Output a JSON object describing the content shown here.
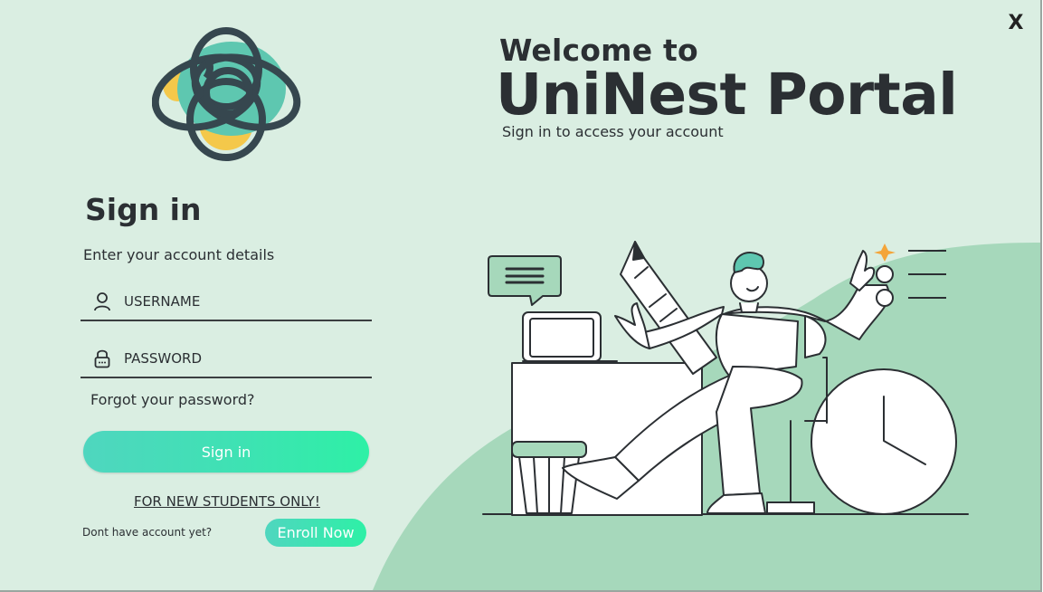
{
  "window": {
    "close_label": "X"
  },
  "hero": {
    "welcome": "Welcome to",
    "title": "UniNest Portal",
    "tagline": "Sign in to access your account"
  },
  "signin": {
    "title": "Sign in",
    "description": "Enter your account details",
    "username_placeholder": "USERNAME",
    "password_placeholder": "PASSWORD",
    "forgot_label": "Forgot your password?",
    "submit_label": "Sign in"
  },
  "enroll": {
    "notice": "FOR NEW STUDENTS ONLY!",
    "prompt": "Dont have account yet?",
    "button_label": "Enroll Now"
  },
  "icons": {
    "logo": "flower-logo-icon",
    "username": "user-icon",
    "password": "lock-icon",
    "illustration": "student-at-desk-illustration"
  },
  "colors": {
    "background": "#daeee2",
    "accent_green": "#a6d8bb",
    "button_start": "#4fd6bf",
    "button_end": "#2ef0a6",
    "text_dark": "#2b2f33",
    "logo_teal": "#5ec7b0",
    "logo_yellow": "#f4c84a",
    "logo_stroke": "#36474f"
  }
}
